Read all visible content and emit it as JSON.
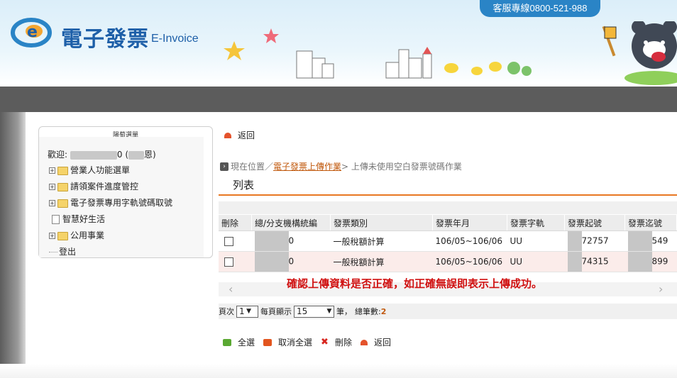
{
  "header": {
    "title": "電子發票",
    "subtitle": "E-Invoice",
    "hotline": "客服專線0800-521-988"
  },
  "sidebar": {
    "title": "陽萄選單",
    "welcome_prefix": "歡迎:",
    "welcome_mid": "0 (",
    "welcome_suffix": "恩)",
    "items": [
      {
        "label": "營業人功能選單",
        "type": "folder"
      },
      {
        "label": "請領案件進度管控",
        "type": "folder"
      },
      {
        "label": "電子發票專用字軌號碼取號",
        "type": "folder"
      },
      {
        "label": "智慧好生活",
        "type": "doc"
      },
      {
        "label": "公用事業",
        "type": "folder"
      },
      {
        "label": "登出",
        "type": "leaf"
      }
    ]
  },
  "main": {
    "back_label": "返回",
    "breadcrumb": {
      "prefix": "現在位置／",
      "link": "電子發票上傳作業",
      "current": "> 上傳未使用空白發票號碼作業"
    },
    "tab_label": "列表",
    "table": {
      "headers": [
        "刪除",
        "總/分支機構統編",
        "發票類別",
        "發票年月",
        "發票字軌",
        "發票起號",
        "發票迄號"
      ],
      "rows": [
        {
          "unit_id_suffix": "0",
          "category": "一般稅額計算",
          "period": "106/05~106/06",
          "track": "UU",
          "start_suffix": "72757",
          "end_suffix": "549"
        },
        {
          "unit_id_suffix": "0",
          "category": "一般稅額計算",
          "period": "106/05~106/06",
          "track": "UU",
          "start_suffix": "74315",
          "end_suffix": "899"
        }
      ]
    },
    "notice": "確認上傳資料是否正確，如正確無誤即表示上傳成功。",
    "pager": {
      "page_label": "頁次",
      "page_value": "1",
      "per_page_label": "每頁顯示",
      "per_page_value": "15",
      "unit": "筆，",
      "total_label": "總筆數:",
      "total_value": "2"
    },
    "actions": {
      "select_all": "全選",
      "deselect_all": "取消全選",
      "delete": "刪除",
      "back": "返回"
    }
  }
}
